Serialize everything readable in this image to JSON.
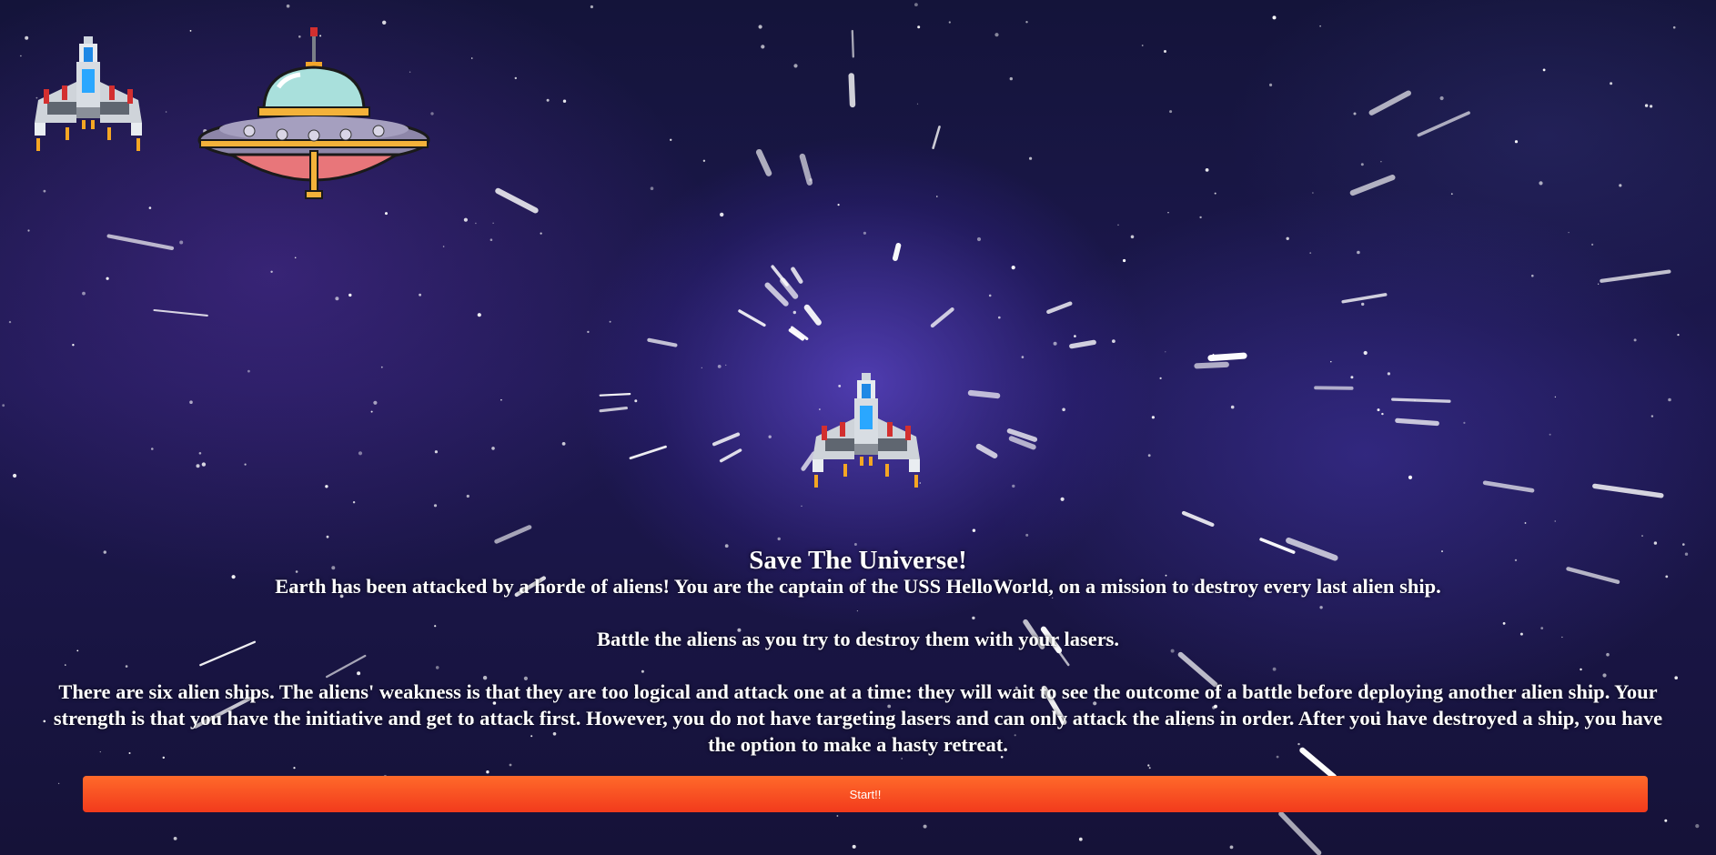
{
  "intro": {
    "title": "Save The Universe!",
    "paragraphs": [
      "Earth has been attacked by a horde of aliens! You are the captain of the USS HelloWorld, on a mission to destroy every last alien ship.",
      "Battle the aliens as you try to destroy them with your lasers.",
      "There are six alien ships. The aliens' weakness is that they are too logical and attack one at a time: they will wait to see the outcome of a battle before deploying another alien ship. Your strength is that you have the initiative and get to attack first. However, you do not have targeting lasers and can only attack the aliens in order. After you have destroyed a ship, you have the option to make a hasty retreat."
    ]
  },
  "start_button": {
    "label": "Start!!"
  },
  "sprites": {
    "player_ship": "player-spaceship",
    "icon_ship": "player-spaceship",
    "alien_ship": "alien-ufo"
  },
  "colors": {
    "button": "#f24a1f",
    "text": "#ffffff",
    "ship_accent": "#1e90ff",
    "ufo_dome": "#a9e0dc"
  }
}
